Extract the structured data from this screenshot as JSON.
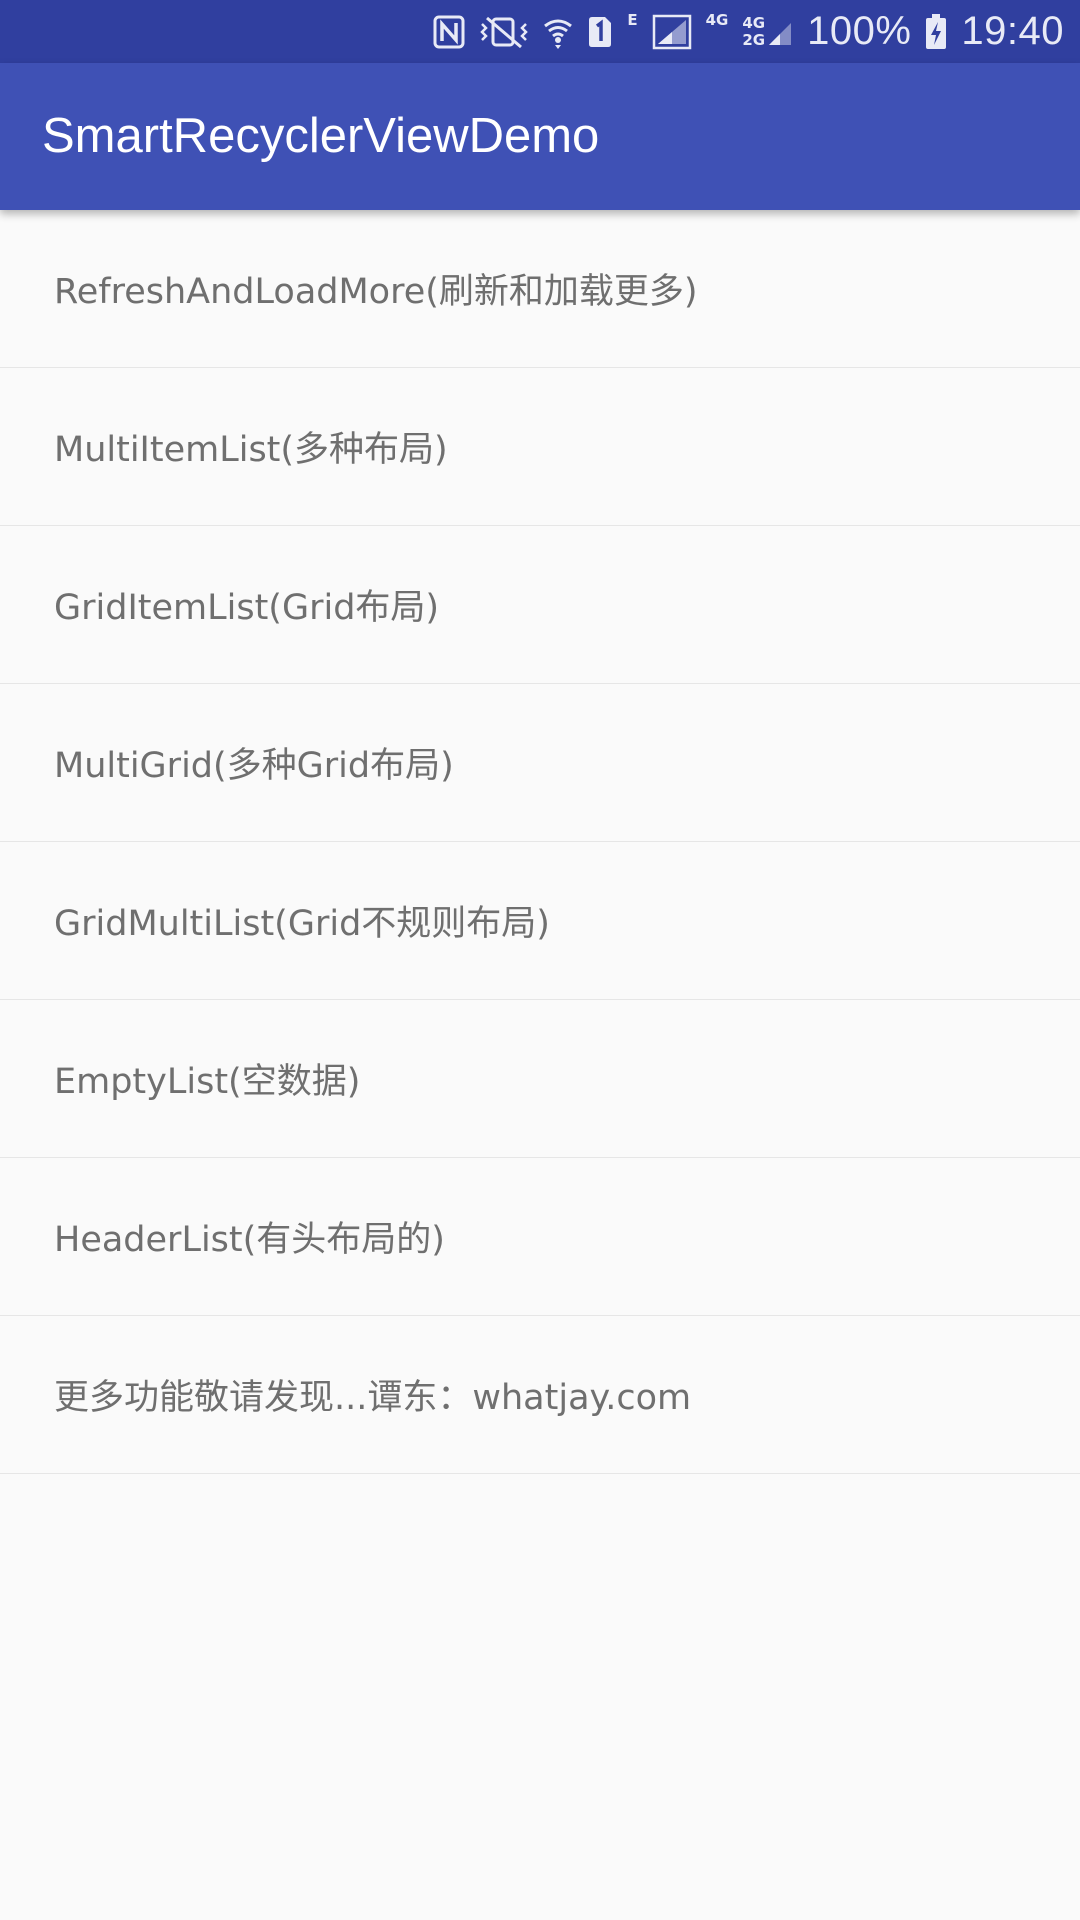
{
  "status_bar": {
    "icons": [
      "nfc-icon",
      "vibrate-icon",
      "wifi-icon",
      "sim1-icon",
      "signal-icon",
      "battery-charging-icon"
    ],
    "network_e": "E",
    "network_4g_a": "4G",
    "network_4g_b": "4G",
    "network_2g": "2G",
    "battery": "100%",
    "time": "19:40",
    "color": "#303f9f"
  },
  "app_bar": {
    "title": "SmartRecyclerViewDemo",
    "color": "#3f51b5"
  },
  "list": {
    "items": [
      {
        "label": "RefreshAndLoadMore(刷新和加载更多)"
      },
      {
        "label": "MultiItemList(多种布局)"
      },
      {
        "label": "GridItemList(Grid布局)"
      },
      {
        "label": "MultiGrid(多种Grid布局)"
      },
      {
        "label": "GridMultiList(Grid不规则布局)"
      },
      {
        "label": "EmptyList(空数据)"
      },
      {
        "label": "HeaderList(有头布局的)"
      },
      {
        "label": "更多功能敬请发现...谭东：whatjay.com"
      }
    ]
  }
}
